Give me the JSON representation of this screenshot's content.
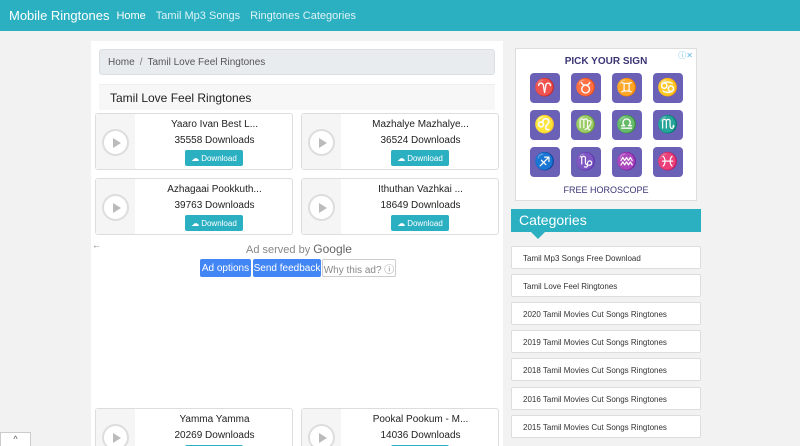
{
  "navbar": {
    "brand": "Mobile Ringtones",
    "links": [
      "Home",
      "Tamil Mp3 Songs",
      "Ringtones Categories"
    ]
  },
  "breadcrumb": {
    "home": "Home",
    "separator": "/",
    "current": "Tamil Love Feel Ringtones"
  },
  "section_title": "Tamil Love Feel Ringtones",
  "download_label": "Download",
  "ringtones": [
    {
      "name": "Yaaro Ivan Best L...",
      "downloads": "35558 Downloads"
    },
    {
      "name": "Mazhalye Mazhalye...",
      "downloads": "36524 Downloads"
    },
    {
      "name": "Azhagaai Pookkuth...",
      "downloads": "39763 Downloads"
    },
    {
      "name": "Ithuthan Vazhkai ...",
      "downloads": "18649 Downloads"
    },
    {
      "name": "Yamma Yamma",
      "downloads": "20269 Downloads"
    },
    {
      "name": "Pookal Pookum - M...",
      "downloads": "14036 Downloads"
    }
  ],
  "ad": {
    "back_arrow": "←",
    "served_by": "Ad served by",
    "served_brand": "Google",
    "options": "Ad options",
    "feedback": "Send feedback",
    "why": "Why this ad? ⓘ"
  },
  "horoscope_ad": {
    "heading": "PICK YOUR SIGN",
    "footer": "FREE HOROSCOPE",
    "ad_mark": "ⓘ✕",
    "signs": [
      "♈",
      "♉",
      "♊",
      "♋",
      "♌",
      "♍",
      "♎",
      "♏",
      "♐",
      "♑",
      "♒",
      "♓"
    ]
  },
  "categories": {
    "title": "Categories",
    "items": [
      "Tamil Mp3 Songs Free Download",
      "Tamil Love Feel Ringtones",
      "2020 Tamil Movies Cut Songs Ringtones",
      "2019 Tamil Movies Cut Songs Ringtones",
      "2018 Tamil Movies Cut Songs Ringtones",
      "2016 Tamil Movies Cut Songs Ringtones",
      "2015 Tamil Movies Cut Songs Ringtones"
    ]
  },
  "scroll_top_icon": "^",
  "colors": {
    "accent": "#2bb0c2",
    "ad_blue": "#4285f4",
    "horoscope_purple": "#6a61b6"
  }
}
